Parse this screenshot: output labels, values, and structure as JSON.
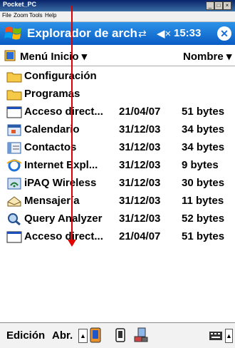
{
  "emulator": {
    "window_title": "Pocket_PC",
    "window_controls": [
      "_",
      "□",
      "×"
    ],
    "menu": [
      "File",
      "Zoom",
      "Tools",
      "Help"
    ]
  },
  "titlebar": {
    "title": "Explorador de arch",
    "clock": "15:33",
    "ok_label": "✕",
    "icons": [
      "windows-logo-icon",
      "connectivity-icon",
      "volume-icon"
    ]
  },
  "header": {
    "location": "Menú Inicio ▾",
    "sort": "Nombre ▾"
  },
  "files": [
    {
      "name": "Configuración",
      "date": "",
      "size": "",
      "icon": "folder-icon"
    },
    {
      "name": "Programas",
      "date": "",
      "size": "",
      "icon": "folder-icon"
    },
    {
      "name": "Acceso direct...",
      "date": "21/04/07",
      "size": "51 bytes",
      "icon": "shortcut-icon"
    },
    {
      "name": "Calendario",
      "date": "31/12/03",
      "size": "34 bytes",
      "icon": "calendar-icon"
    },
    {
      "name": "Contactos",
      "date": "31/12/03",
      "size": "34 bytes",
      "icon": "contacts-icon"
    },
    {
      "name": "Internet Expl...",
      "date": "31/12/03",
      "size": "9 bytes",
      "icon": "internet-explorer-icon"
    },
    {
      "name": "iPAQ Wireless",
      "date": "31/12/03",
      "size": "30 bytes",
      "icon": "wireless-icon"
    },
    {
      "name": "Mensajería",
      "date": "31/12/03",
      "size": "11 bytes",
      "icon": "messaging-icon"
    },
    {
      "name": "Query Analyzer",
      "date": "31/12/03",
      "size": "52 bytes",
      "icon": "query-analyzer-icon"
    },
    {
      "name": "Acceso direct...",
      "date": "21/04/07",
      "size": "51 bytes",
      "icon": "shortcut-icon"
    }
  ],
  "toolbar": {
    "edit": "Edición",
    "open": "Abr.",
    "icons": [
      "up-arrow-icon",
      "phone-icon",
      "sd-card-icon",
      "network-icon",
      "keyboard-icon"
    ]
  },
  "colors": {
    "title_bar": "#0a5cc4",
    "annotation": "#e00000",
    "folder": "#f5c342"
  }
}
